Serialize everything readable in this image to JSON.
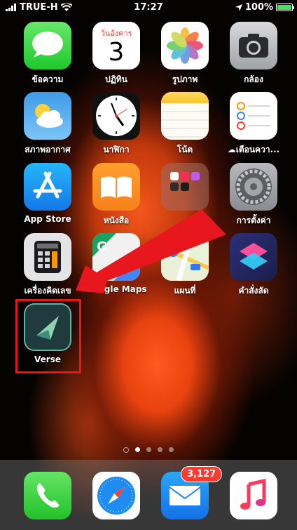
{
  "status_bar": {
    "carrier": "TRUE-H",
    "time": "17:27",
    "battery": "100%"
  },
  "home": {
    "calendar_day": "วันอังคาร",
    "calendar_date": "3",
    "apps": [
      {
        "label": "ข้อความ",
        "icon": "messages-icon"
      },
      {
        "label": "ปฏิทิน",
        "icon": "calendar-icon"
      },
      {
        "label": "รูปภาพ",
        "icon": "photos-icon"
      },
      {
        "label": "กล้อง",
        "icon": "camera-icon"
      },
      {
        "label": "สภาพอากาศ",
        "icon": "weather-icon"
      },
      {
        "label": "นาฬิกา",
        "icon": "clock-icon"
      },
      {
        "label": "โน้ต",
        "icon": "notes-icon"
      },
      {
        "label": "เตือนควา...",
        "icon": "reminders-icon"
      },
      {
        "label": "App Store",
        "icon": "app-store-icon"
      },
      {
        "label": "หนังสือ",
        "icon": "books-icon"
      },
      {
        "label": "",
        "icon": "folder-icon"
      },
      {
        "label": "การตั้งค่า",
        "icon": "settings-icon"
      },
      {
        "label": "เครื่องคิดเลข",
        "icon": "calculator-icon"
      },
      {
        "label": "Google Maps",
        "icon": "google-maps-icon"
      },
      {
        "label": "แผนที่",
        "icon": "maps-icon"
      },
      {
        "label": "คำสั่งลัด",
        "icon": "shortcuts-icon"
      },
      {
        "label": "Verse",
        "icon": "verse-icon"
      }
    ],
    "highlight_color": "#e8161d"
  },
  "dock": {
    "mail_badge": "3,127",
    "apps": [
      "phone-icon",
      "safari-icon",
      "mail-icon",
      "music-icon"
    ]
  }
}
